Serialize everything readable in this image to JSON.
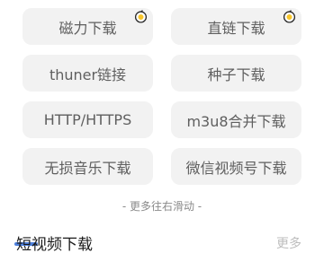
{
  "tiles": [
    {
      "label": "磁力下载",
      "badge": true
    },
    {
      "label": "直链下载",
      "badge": true
    },
    {
      "label": "thuner链接",
      "badge": false
    },
    {
      "label": "种子下载",
      "badge": false
    },
    {
      "label": "HTTP/HTTPS",
      "badge": false
    },
    {
      "label": "m3u8合并下载",
      "badge": false
    },
    {
      "label": "无损音乐下载",
      "badge": false
    },
    {
      "label": "微信视频号下载",
      "badge": false
    }
  ],
  "scroll_hint": "- 更多往右滑动 -",
  "section": {
    "title": "短视频下载",
    "more_label": "更多"
  },
  "colors": {
    "tile_bg": "#f2f2f2",
    "tile_text": "#5f5f5f",
    "badge_ring": "#2b2b2b",
    "badge_fill": "#f7c52a",
    "accent": "#2f6ad6"
  }
}
